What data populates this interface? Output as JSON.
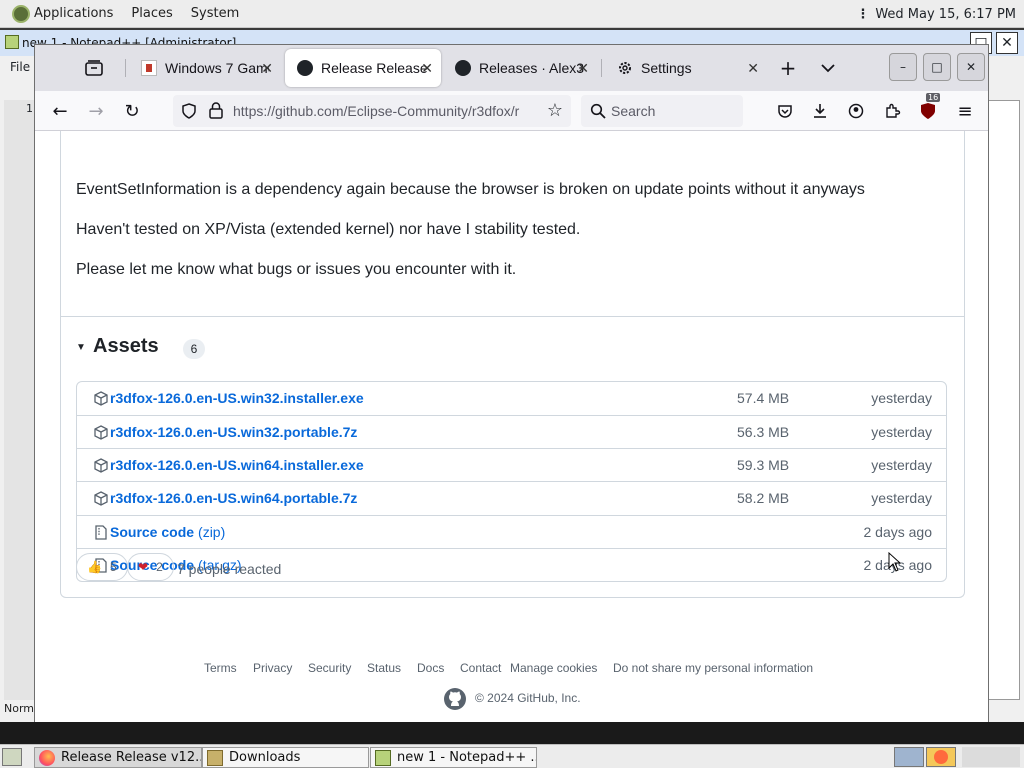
{
  "top_panel": {
    "menus": [
      "Applications",
      "Places",
      "System"
    ],
    "clock": "Wed May 15,  6:17 PM"
  },
  "notepad": {
    "title": "new 1 - Notepad++ [Administrator]",
    "menu_file": "File",
    "status": "Norm",
    "line_number": "1"
  },
  "firefox": {
    "tabs": [
      {
        "label": "Windows 7 Game",
        "icon": "windows-game-icon"
      },
      {
        "label": "Release Release v",
        "icon": "github-icon"
      },
      {
        "label": "Releases · Alex31",
        "icon": "github-icon"
      },
      {
        "label": "Settings",
        "icon": "gear-icon"
      }
    ],
    "url": "https://github.com/Eclipse-Community/r3dfox/r",
    "search_placeholder": "Search",
    "extension_badge": "16"
  },
  "release": {
    "paragraphs": [
      "EventSetInformation is a dependency again because the browser is broken on update points without it anyways",
      "Haven't tested on XP/Vista (extended kernel) nor have I stability tested.",
      "Please let me know what bugs or issues you encounter with it."
    ],
    "assets_title": "Assets",
    "assets_count": "6",
    "assets": [
      {
        "name": "r3dfox-126.0.en-US.win32.installer.exe",
        "kind": "",
        "size": "57.4 MB",
        "date": "yesterday",
        "icon": "package-icon"
      },
      {
        "name": "r3dfox-126.0.en-US.win32.portable.7z",
        "kind": "",
        "size": "56.3 MB",
        "date": "yesterday",
        "icon": "package-icon"
      },
      {
        "name": "r3dfox-126.0.en-US.win64.installer.exe",
        "kind": "",
        "size": "59.3 MB",
        "date": "yesterday",
        "icon": "package-icon"
      },
      {
        "name": "r3dfox-126.0.en-US.win64.portable.7z",
        "kind": "",
        "size": "58.2 MB",
        "date": "yesterday",
        "icon": "package-icon"
      },
      {
        "name": "Source code",
        "kind": "(zip)",
        "size": "",
        "date": "2 days ago",
        "icon": "zip-file-icon"
      },
      {
        "name": "Source code",
        "kind": "(tar.gz)",
        "size": "",
        "date": "2 days ago",
        "icon": "zip-file-icon"
      }
    ],
    "reactions": [
      {
        "emoji": "👍",
        "count": "5"
      },
      {
        "emoji": "❤",
        "count": "2"
      }
    ],
    "reacted_text": "7 people reacted"
  },
  "footer": {
    "links": [
      "Terms",
      "Privacy",
      "Security",
      "Status",
      "Docs",
      "Contact",
      "Manage cookies",
      "Do not share my personal information"
    ],
    "copyright": "© 2024 GitHub, Inc."
  },
  "taskbar": {
    "items": [
      {
        "label": "Release Release v12...",
        "icon": "firefox-icon"
      },
      {
        "label": "Downloads",
        "icon": "folder-icon"
      },
      {
        "label": "new 1 - Notepad++ ...",
        "icon": "notepad-icon"
      }
    ]
  },
  "colors": {
    "link": "#0969da",
    "muted": "#59636e",
    "border": "#d0d7de",
    "tabbar": "#e1e1e7"
  }
}
